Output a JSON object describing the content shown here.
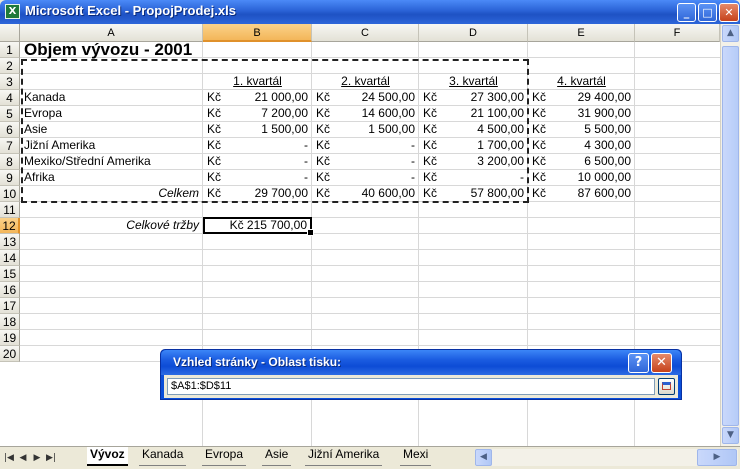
{
  "window": {
    "app_icon": "X",
    "title": "Microsoft Excel - PropojProdej.xls",
    "minimize_glyph": "_",
    "maximize_glyph": "□",
    "close_glyph": "✕"
  },
  "columns": [
    "A",
    "B",
    "C",
    "D",
    "E",
    "F"
  ],
  "rows": [
    "1",
    "2",
    "3",
    "4",
    "5",
    "6",
    "7",
    "8",
    "9",
    "10",
    "11",
    "12",
    "13",
    "14",
    "15",
    "16",
    "17",
    "18",
    "19",
    "20"
  ],
  "selection": {
    "column": "B",
    "row": "12"
  },
  "sheet": {
    "title": "Objem vývozu - 2001",
    "quarters": [
      "1. kvartál",
      "2. kvartál",
      "3. kvartál",
      "4. kvartál"
    ],
    "currency": "Kč",
    "regions": [
      {
        "name": "Kanada",
        "values": [
          "21 000,00",
          "24 500,00",
          "27 300,00",
          "29 400,00"
        ]
      },
      {
        "name": "Evropa",
        "values": [
          "7 200,00",
          "14 600,00",
          "21 100,00",
          "31 900,00"
        ]
      },
      {
        "name": "Asie",
        "values": [
          "1 500,00",
          "1 500,00",
          "4 500,00",
          "5 500,00"
        ]
      },
      {
        "name": "Jižní Amerika",
        "values": [
          "-",
          "-",
          "1 700,00",
          "4 300,00"
        ]
      },
      {
        "name": "Mexiko/Střední Amerika",
        "values": [
          "-",
          "-",
          "3 200,00",
          "6 500,00"
        ]
      },
      {
        "name": "Afrika",
        "values": [
          "-",
          "-",
          "-",
          "10 000,00"
        ]
      }
    ],
    "total_label": "Celkem",
    "totals": [
      "29 700,00",
      "40 600,00",
      "57 800,00",
      "87 600,00"
    ],
    "grand_total_label": "Celkové tržby",
    "grand_total": "Kč 215 700,00"
  },
  "dialog": {
    "title": "Vzhled stránky - Oblast tisku:",
    "value": "$A$1:$D$11",
    "help_glyph": "?",
    "close_glyph": "✕"
  },
  "sheet_tabs": {
    "nav": [
      "|◀",
      "◀",
      "▶",
      "▶|"
    ],
    "tabs": [
      "Vývoz",
      "Kanada",
      "Evropa",
      "Asie",
      "Jižní Amerika",
      "Mexi"
    ],
    "active": "Vývoz"
  }
}
